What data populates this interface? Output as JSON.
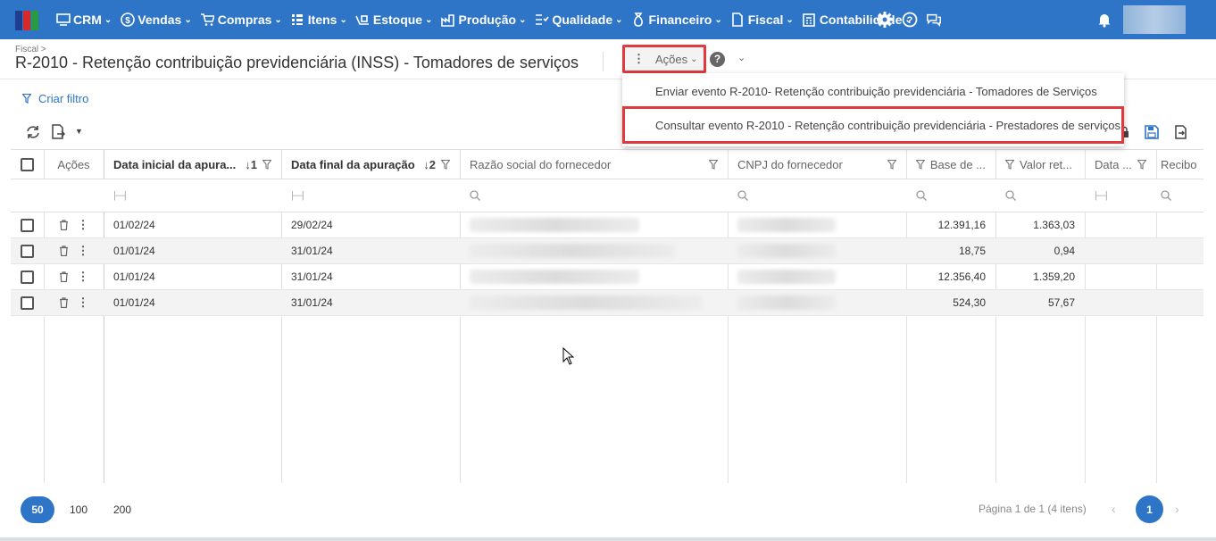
{
  "nav": {
    "items": [
      {
        "label": "CRM",
        "icon": "crm-icon"
      },
      {
        "label": "Vendas",
        "icon": "dollar-icon"
      },
      {
        "label": "Compras",
        "icon": "cart-icon"
      },
      {
        "label": "Itens",
        "icon": "items-icon"
      },
      {
        "label": "Estoque",
        "icon": "stock-icon"
      },
      {
        "label": "Produção",
        "icon": "factory-icon"
      },
      {
        "label": "Qualidade",
        "icon": "quality-icon"
      },
      {
        "label": "Financeiro",
        "icon": "money-bag-icon"
      },
      {
        "label": "Fiscal",
        "icon": "document-icon"
      },
      {
        "label": "Contabilidade",
        "icon": "calculator-icon"
      }
    ],
    "bg_color": "#2e75c7"
  },
  "header": {
    "breadcrumb": "Fiscal >",
    "title": "R-2010 - Retenção contribuição previdenciária (INSS) - Tomadores de serviços",
    "actions_label": "Ações"
  },
  "actions_menu": {
    "items": [
      "Enviar evento R-2010- Retenção contribuição previdenciária - Tomadores de Serviços",
      "Consultar evento R-2010 - Retenção contribuição previdenciária - Prestadores de serviços"
    ]
  },
  "filter": {
    "create_label": "Criar filtro"
  },
  "table": {
    "headers": {
      "actions": "Ações",
      "data_inicial": "Data inicial da apura...",
      "data_inicial_sort": "1",
      "data_final": "Data final da apuração",
      "data_final_sort": "2",
      "razao_social": "Razão social do fornecedor",
      "cnpj": "CNPJ do fornecedor",
      "base": "Base de ...",
      "valor": "Valor ret...",
      "data": "Data ...",
      "recibo": "Recibo"
    },
    "rows": [
      {
        "data_inicial": "01/02/24",
        "data_final": "29/02/24",
        "base": "12.391,16",
        "valor": "1.363,03"
      },
      {
        "data_inicial": "01/01/24",
        "data_final": "31/01/24",
        "base": "18,75",
        "valor": "0,94"
      },
      {
        "data_inicial": "01/01/24",
        "data_final": "31/01/24",
        "base": "12.356,40",
        "valor": "1.359,20"
      },
      {
        "data_inicial": "01/01/24",
        "data_final": "31/01/24",
        "base": "524,30",
        "valor": "57,67"
      }
    ]
  },
  "pagination": {
    "sizes": [
      "50",
      "100",
      "200"
    ],
    "info": "Página 1 de 1 (4 itens)",
    "current": "1"
  },
  "colors": {
    "accent": "#2e75c7",
    "highlight": "#e0393e"
  }
}
